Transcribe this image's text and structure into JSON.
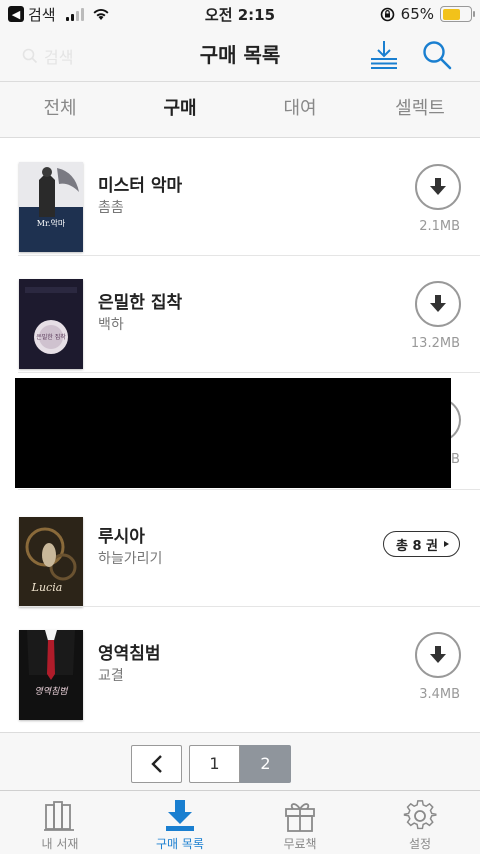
{
  "status_bar": {
    "back_label": "검색",
    "time": "오전 2:15",
    "battery_percent_label": "65%",
    "battery_level": 0.65
  },
  "header": {
    "title": "구매 목록",
    "ghost_search_text": "검색"
  },
  "tabs": [
    {
      "label": "전체",
      "active": false
    },
    {
      "label": "구매",
      "active": true
    },
    {
      "label": "대여",
      "active": false
    },
    {
      "label": "셀렉트",
      "active": false
    }
  ],
  "books": [
    {
      "title": "미스터 악마",
      "author": "촘촘",
      "size": "2.1MB",
      "cover_text": "Mr.악마"
    },
    {
      "title": "은밀한 집착",
      "author": "백하",
      "size": "13.2MB",
      "cover_text": "은밀한 집착"
    },
    {
      "title": "",
      "author": "",
      "size": "B",
      "redacted": true
    },
    {
      "title": "루시아",
      "author": "하늘가리기",
      "volume_count": "총 8 권",
      "cover_text": "Lucia"
    },
    {
      "title": "영역침범",
      "author": "교결",
      "size": "3.4MB",
      "cover_text": "영역침범"
    }
  ],
  "pagination": {
    "prev_icon": "chevron-left-icon",
    "pages": [
      "1",
      "2"
    ],
    "current": "2"
  },
  "bottom_nav": [
    {
      "label": "내 서재",
      "icon": "bookshelf-icon",
      "active": false
    },
    {
      "label": "구매 목록",
      "icon": "download-tray-icon",
      "active": true
    },
    {
      "label": "무료책",
      "icon": "gift-icon",
      "active": false
    },
    {
      "label": "설정",
      "icon": "gear-icon",
      "active": false
    }
  ],
  "colors": {
    "accent": "#1a7fd0",
    "battery": "#f2c21a",
    "muted_text": "#888888"
  }
}
